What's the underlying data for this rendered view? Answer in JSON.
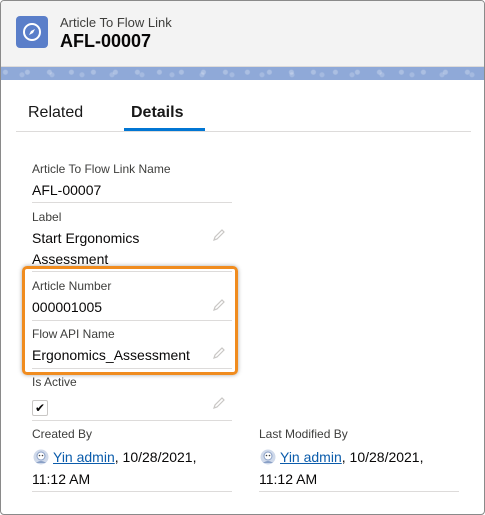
{
  "header": {
    "object_type": "Article To Flow Link",
    "record_name": "AFL-00007",
    "icon": "compass-icon"
  },
  "tabs": [
    {
      "label": "Related",
      "active": false
    },
    {
      "label": "Details",
      "active": true
    }
  ],
  "fields": {
    "name": {
      "label": "Article To Flow Link Name",
      "value": "AFL-00007"
    },
    "label": {
      "label": "Label",
      "value_line1": "Start Ergonomics",
      "value_line2": "Assessment"
    },
    "article_number": {
      "label": "Article Number",
      "value": "000001005"
    },
    "flow_api_name": {
      "label": "Flow API Name",
      "value": "Ergonomics_Assessment"
    },
    "is_active": {
      "label": "Is Active",
      "checked": true,
      "check_glyph": "✔"
    },
    "created_by": {
      "label": "Created By",
      "user": "Yin admin",
      "date_part": ", 10/28/2021,",
      "time_part": "11:12 AM"
    },
    "last_modified_by": {
      "label": "Last Modified By",
      "user": "Yin admin",
      "date_part": ", 10/28/2021,",
      "time_part": "11:12 AM"
    }
  },
  "colors": {
    "accent": "#0176d3",
    "highlight": "#f08c1f",
    "icon_bg": "#5a7ec9"
  }
}
